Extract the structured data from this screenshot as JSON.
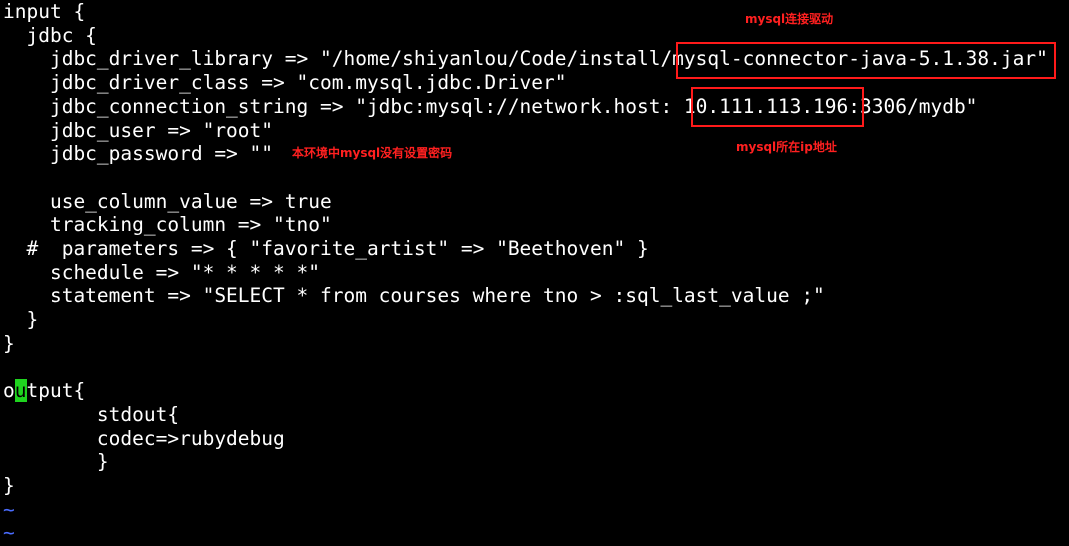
{
  "editor": {
    "lines": [
      "input {",
      "  jdbc {",
      "    jdbc_driver_library => \"/home/shiyanlou/Code/install/mysql-connector-java-5.1.38.jar\"",
      "    jdbc_driver_class => \"com.mysql.jdbc.Driver\"",
      "    jdbc_connection_string => \"jdbc:mysql://network.host: 10.111.113.196:3306/mydb\"",
      "    jdbc_user => \"root\"",
      "    jdbc_password => \"\"",
      "",
      "    use_column_value => true",
      "    tracking_column => \"tno\"",
      "  #  parameters => { \"favorite_artist\" => \"Beethoven\" }",
      "    schedule => \"* * * * *\"",
      "    statement => \"SELECT * from courses where tno > :sql_last_value ;\"",
      "  }",
      "}",
      "",
      "output{",
      "        stdout{",
      "        codec=>rubydebug",
      "        }",
      "}",
      "~",
      "~"
    ],
    "cursor_line_before": "o",
    "cursor_char": "u",
    "cursor_line_after": "tput{"
  },
  "annotations": {
    "driver_note": "mysql连接驱动",
    "ip_note": "mysql所在ip地址",
    "password_note": "本环境中mysql没有设置密码"
  },
  "colors": {
    "background": "#000000",
    "text": "#ffffff",
    "annotation": "#ff2020",
    "cursor": "#1fd41f",
    "tilde": "#4a6cff"
  }
}
